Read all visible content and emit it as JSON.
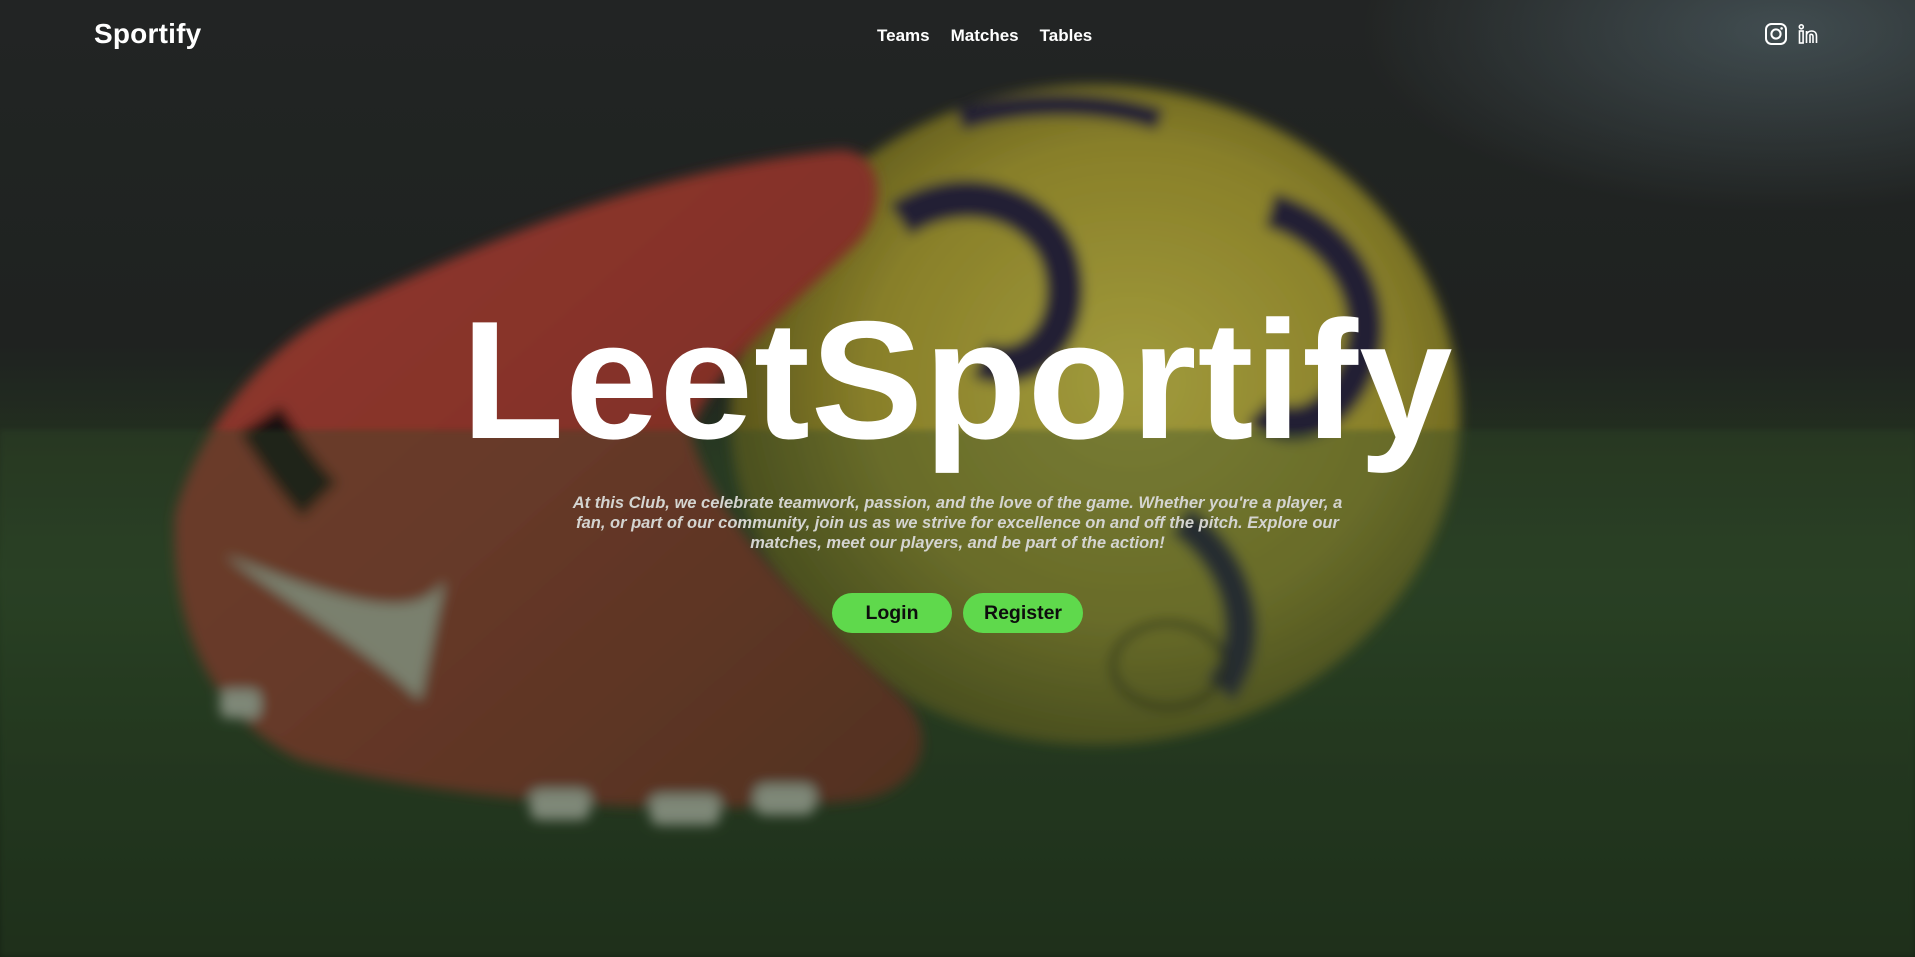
{
  "nav": {
    "brand": "Sportify",
    "links": [
      {
        "label": "Teams"
      },
      {
        "label": "Matches"
      },
      {
        "label": "Tables"
      }
    ],
    "social": [
      {
        "icon": "instagram-icon"
      },
      {
        "icon": "linkedin-icon"
      }
    ]
  },
  "hero": {
    "title": "LeetSportify",
    "tagline": "At this Club, we celebrate teamwork, passion, and the love of the game. Whether you're a player, a fan, or part of our community, join us as we strive for excellence on and off the pitch. Explore our matches, meet our players, and be part of the action!",
    "login_label": "Login",
    "register_label": "Register"
  },
  "colors": {
    "accent": "#5fd94c",
    "text": "#ffffff",
    "tagline": "#d4d4d0"
  }
}
